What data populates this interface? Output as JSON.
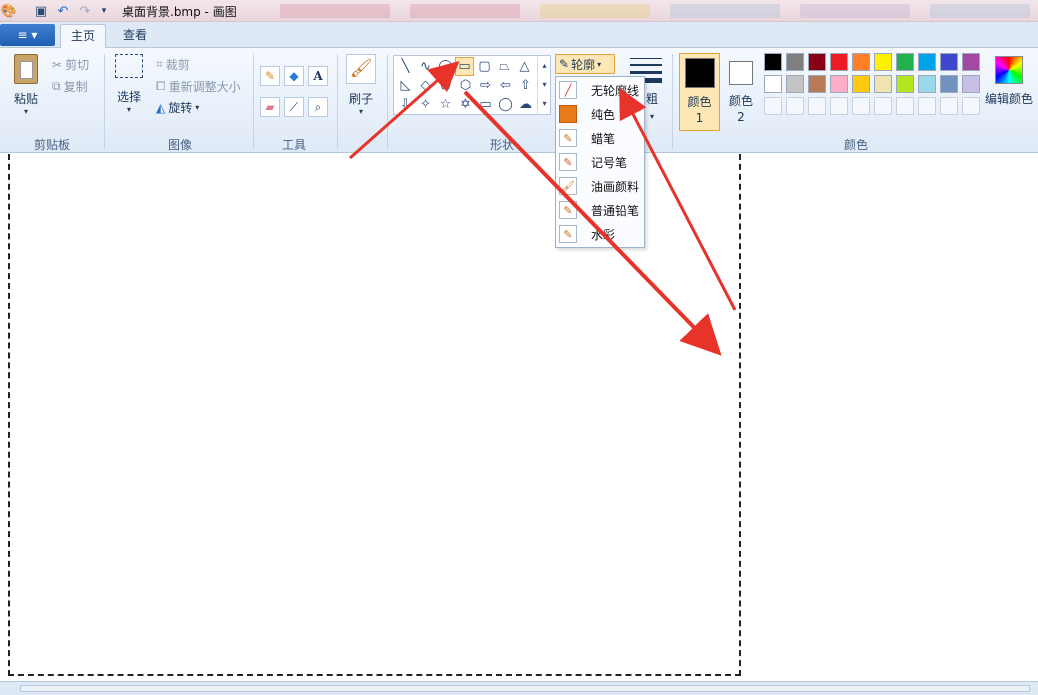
{
  "window": {
    "title": "桌面背景.bmp - 画图"
  },
  "tabs": [
    {
      "label": "主页"
    },
    {
      "label": "查看"
    }
  ],
  "clipboard": {
    "paste_label": "粘贴",
    "cut_label": "剪切",
    "copy_label": "复制",
    "group_label": "剪贴板"
  },
  "image": {
    "select_label": "选择",
    "crop_label": "裁剪",
    "resize_label": "重新调整大小",
    "rotate_label": "旋转",
    "group_label": "图像"
  },
  "tools": {
    "group_label": "工具",
    "text_glyph": "A"
  },
  "brush": {
    "label": "刷子"
  },
  "shapes": {
    "group_label": "形状",
    "outline_label": "轮廓"
  },
  "size": {
    "label": "粗"
  },
  "colors": {
    "color1_label": "颜色 1",
    "color2_label": "颜色 2",
    "edit_label": "编辑颜色",
    "group_label": "颜色",
    "color1_value": "#000000",
    "color2_value": "#ffffff",
    "palette_row1": [
      "#000000",
      "#7f7f7f",
      "#880015",
      "#ed1c24",
      "#ff7f27",
      "#fff200",
      "#22b14c",
      "#00a2e8",
      "#3f48cc",
      "#a349a4"
    ],
    "palette_row2": [
      "#ffffff",
      "#c3c3c3",
      "#b97a57",
      "#ffaec9",
      "#ffc90e",
      "#efe4b0",
      "#b5e61d",
      "#99d9ea",
      "#7092be",
      "#c8bfe7"
    ]
  },
  "outline_menu": {
    "items": [
      {
        "label": "无轮廓线",
        "icon": "no-outline-icon"
      },
      {
        "label": "纯色",
        "icon": "solid-color-icon"
      },
      {
        "label": "蜡笔",
        "icon": "crayon-icon"
      },
      {
        "label": "记号笔",
        "icon": "marker-icon"
      },
      {
        "label": "油画颜料",
        "icon": "oil-paint-icon"
      },
      {
        "label": "普通铅笔",
        "icon": "pencil-icon"
      },
      {
        "label": "水彩",
        "icon": "watercolor-icon"
      }
    ]
  },
  "annotation_color": "#e8332b"
}
